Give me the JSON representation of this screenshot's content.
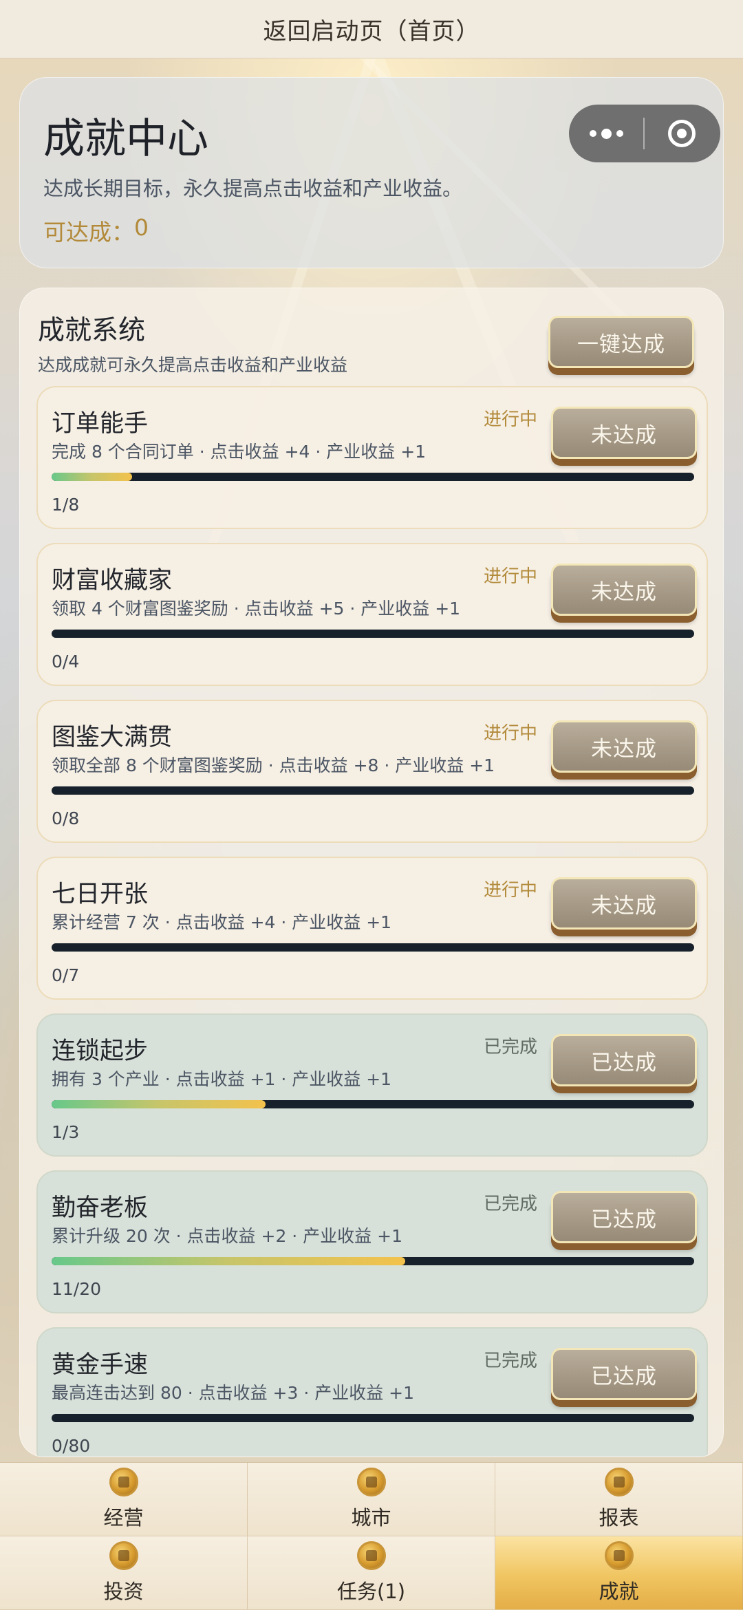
{
  "top_bar": {
    "title": "返回启动页（首页）"
  },
  "header": {
    "title": "成就中心",
    "subtitle": "达成长期目标，永久提高点击收益和产业收益。",
    "available_label": "可达成：",
    "available_count": "0"
  },
  "capsule": {
    "more_icon": "more-dots-icon",
    "close_icon": "target-icon"
  },
  "system": {
    "title": "成就系统",
    "subtitle": "达成成就可永久提高点击收益和产业收益",
    "one_click_label": "一键达成"
  },
  "achievements": [
    {
      "name": "订单能手",
      "desc": "完成 8 个合同订单 · 点击收益 +4 · 产业收益 +1",
      "status": "进行中",
      "button": "未达成",
      "progress": "1/8",
      "current": 1,
      "target": 8,
      "done": false
    },
    {
      "name": "财富收藏家",
      "desc": "领取 4 个财富图鉴奖励 · 点击收益 +5 · 产业收益 +1",
      "status": "进行中",
      "button": "未达成",
      "progress": "0/4",
      "current": 0,
      "target": 4,
      "done": false
    },
    {
      "name": "图鉴大满贯",
      "desc": "领取全部 8 个财富图鉴奖励 · 点击收益 +8 · 产业收益 +1",
      "status": "进行中",
      "button": "未达成",
      "progress": "0/8",
      "current": 0,
      "target": 8,
      "done": false
    },
    {
      "name": "七日开张",
      "desc": "累计经营 7 次 · 点击收益 +4 · 产业收益 +1",
      "status": "进行中",
      "button": "未达成",
      "progress": "0/7",
      "current": 0,
      "target": 7,
      "done": false
    },
    {
      "name": "连锁起步",
      "desc": "拥有 3 个产业 · 点击收益 +1 · 产业收益 +1",
      "status": "已完成",
      "button": "已达成",
      "progress": "1/3",
      "current": 1,
      "target": 3,
      "done": true
    },
    {
      "name": "勤奋老板",
      "desc": "累计升级 20 次 · 点击收益 +2 · 产业收益 +1",
      "status": "已完成",
      "button": "已达成",
      "progress": "11/20",
      "current": 11,
      "target": 20,
      "done": true
    },
    {
      "name": "黄金手速",
      "desc": "最高连击达到 80 · 点击收益 +3 · 产业收益 +1",
      "status": "已完成",
      "button": "已达成",
      "progress": "0/80",
      "current": 0,
      "target": 80,
      "done": true
    }
  ],
  "tabs": [
    {
      "label": "经营",
      "icon": "business-coin-icon",
      "active": false
    },
    {
      "label": "城市",
      "icon": "city-coin-icon",
      "active": false
    },
    {
      "label": "报表",
      "icon": "report-chart-icon",
      "active": false
    },
    {
      "label": "投资",
      "icon": "investment-coin-icon",
      "active": false
    },
    {
      "label": "任务(1)",
      "icon": "task-scroll-icon",
      "active": false
    },
    {
      "label": "成就",
      "icon": "achievement-medal-icon",
      "active": true
    }
  ]
}
